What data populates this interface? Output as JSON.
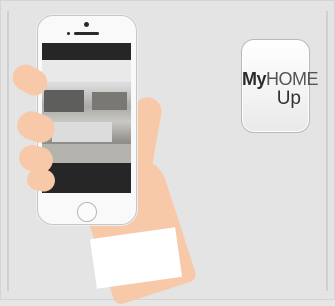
{
  "app_icon": {
    "line1_bold": "My",
    "line1_light": "HOME",
    "line2": "Up"
  }
}
